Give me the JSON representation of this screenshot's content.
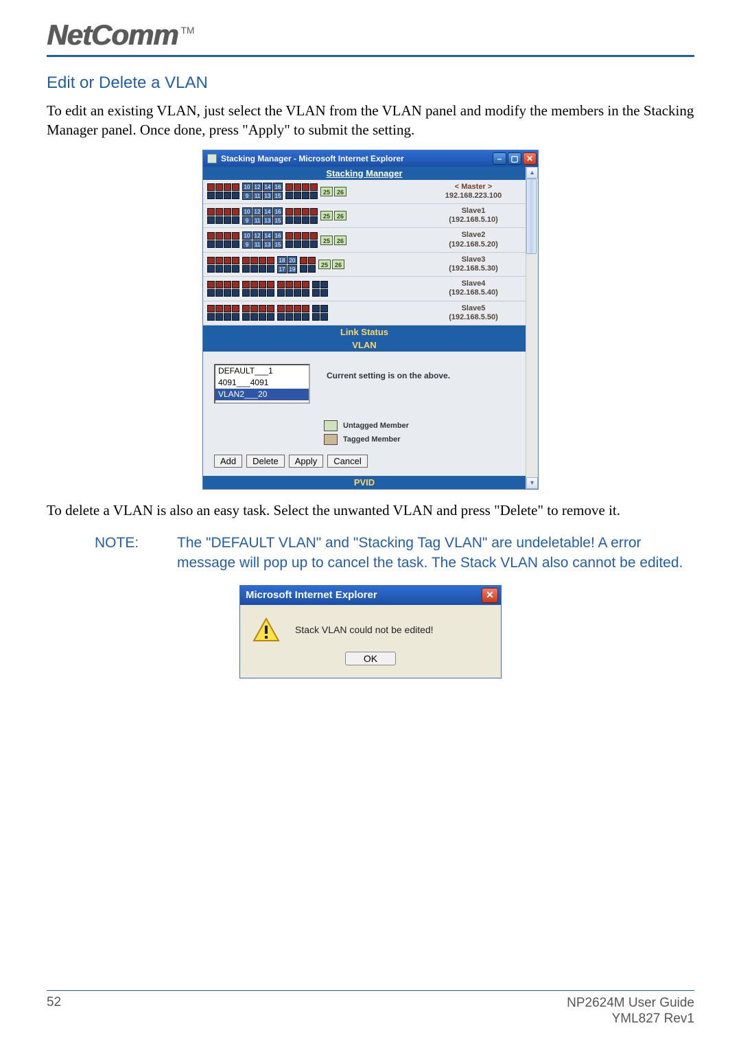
{
  "brand": {
    "name": "NetComm",
    "tm": "TM"
  },
  "section_heading": "Edit or Delete a VLAN",
  "intro": "To edit an existing VLAN, just select the VLAN from the VLAN panel and modify the members in the Stacking Manager panel.  Once done, press \"Apply\" to submit the setting.",
  "sm": {
    "title": "Stacking Manager - Microsoft Internet Explorer",
    "header": "Stacking Manager",
    "port_nums_top": [
      "10",
      "12",
      "14",
      "16"
    ],
    "port_nums_bot": [
      "9",
      "11",
      "13",
      "15"
    ],
    "port_nums_b_top": [
      "18",
      "20"
    ],
    "port_nums_b_bot": [
      "17",
      "19"
    ],
    "tag_a": "25",
    "tag_b": "26",
    "devices": [
      {
        "name": "< Master >",
        "ip": "192.168.223.100",
        "master": true,
        "layout": "a"
      },
      {
        "name": "Slave1",
        "ip": "(192.168.5.10)",
        "master": false,
        "layout": "a"
      },
      {
        "name": "Slave2",
        "ip": "(192.168.5.20)",
        "master": false,
        "layout": "a"
      },
      {
        "name": "Slave3",
        "ip": "(192.168.5.30)",
        "master": false,
        "layout": "b"
      },
      {
        "name": "Slave4",
        "ip": "(192.168.5.40)",
        "master": false,
        "layout": "c"
      },
      {
        "name": "Slave5",
        "ip": "(192.168.5.50)",
        "master": false,
        "layout": "c"
      }
    ],
    "band_link": "Link Status",
    "band_vlan": "VLAN",
    "band_pvid": "PVID",
    "vlan_options": [
      {
        "text": "DEFAULT___1",
        "sel": false
      },
      {
        "text": "4091___4091",
        "sel": false
      },
      {
        "text": "VLAN2___20",
        "sel": true
      }
    ],
    "vlan_msg": "Current setting is on the above.",
    "legend_untag": "Untagged Member",
    "legend_tag": "Tagged Member",
    "buttons": {
      "add": "Add",
      "delete": "Delete",
      "apply": "Apply",
      "cancel": "Cancel"
    }
  },
  "para2": "To delete a VLAN is also an easy task.  Select the unwanted VLAN and press \"Delete\" to remove it.",
  "note": {
    "label": "NOTE:",
    "text": "The \"DEFAULT VLAN\" and \"Stacking Tag VLAN\" are undeletable! A error message will pop up to cancel the task.  The Stack VLAN also cannot be edited."
  },
  "alert": {
    "title": "Microsoft Internet Explorer",
    "message": "Stack VLAN could not be edited!",
    "ok": "OK"
  },
  "footer": {
    "page": "52",
    "line1": "NP2624M User Guide",
    "line2": "YML827 Rev1"
  }
}
